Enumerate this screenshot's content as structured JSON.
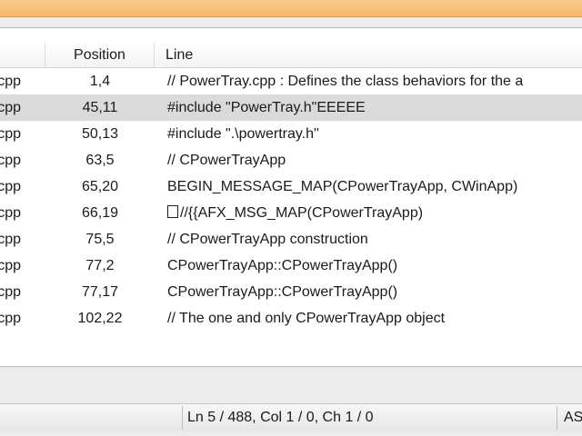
{
  "results": {
    "columns": {
      "position": "Position",
      "line": "Line"
    },
    "rows": [
      {
        "file": "y.cpp",
        "position": "1,4",
        "line": "// PowerTray.cpp : Defines the class behaviors for the a"
      },
      {
        "file": "y.cpp",
        "position": "45,11",
        "line": "#include \"PowerTray.h\"EEEEE",
        "selected": true
      },
      {
        "file": "y.cpp",
        "position": "50,13",
        "line": "#include \".\\powertray.h\""
      },
      {
        "file": "y.cpp",
        "position": "63,5",
        "line": "// CPowerTrayApp"
      },
      {
        "file": "y.cpp",
        "position": "65,20",
        "line": "BEGIN_MESSAGE_MAP(CPowerTrayApp, CWinApp)"
      },
      {
        "file": "y.cpp",
        "position": "66,19",
        "line": "//{{AFX_MSG_MAP(CPowerTrayApp)",
        "leading_box": true
      },
      {
        "file": "y.cpp",
        "position": "75,5",
        "line": "// CPowerTrayApp construction"
      },
      {
        "file": "y.cpp",
        "position": "77,2",
        "line": "CPowerTrayApp::CPowerTrayApp()"
      },
      {
        "file": "y.cpp",
        "position": "77,17",
        "line": "CPowerTrayApp::CPowerTrayApp()"
      },
      {
        "file": "y.cpp",
        "position": "102,22",
        "line": "// The one and only CPowerTrayApp object"
      }
    ]
  },
  "statusbar": {
    "cursor": "Ln 5 / 488, Col 1 / 0, Ch 1 / 0",
    "mode": "AS"
  },
  "colors": {
    "title_accent": "#f6b86a",
    "selected_row": "#dadada"
  }
}
